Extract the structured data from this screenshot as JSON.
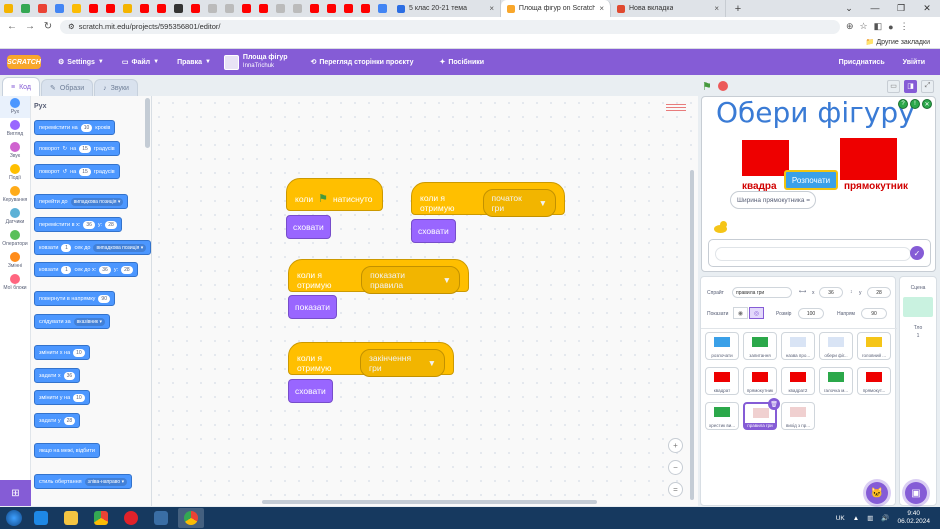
{
  "browser": {
    "tabs": [
      {
        "title": "5 клас 20-21 тема",
        "active": false,
        "color": "#2b6de3"
      },
      {
        "title": "Площа фігур on Scratch",
        "active": true,
        "color": "#f9a72b"
      },
      {
        "title": "Нова вкладка",
        "active": false,
        "color": "#e0492f"
      }
    ],
    "url": "scratch.mit.edu/projects/595356801/editor/",
    "other_bookmarks": "Другие закладки"
  },
  "menubar": {
    "logo": "SCRATCH",
    "settings": "Settings",
    "file": "Файл",
    "edit": "Правка",
    "project_title": "Площа фігур",
    "project_author": "InnaTrichuk",
    "see_project": "Перегляд сторінки проєкту",
    "tutorials": "Посібники",
    "share": "Присднатись",
    "signin": "Увійти"
  },
  "editor_tabs": {
    "code": "Код",
    "costumes": "Образи",
    "sounds": "Звуки"
  },
  "categories": [
    {
      "label": "Рух",
      "color": "#4c97ff"
    },
    {
      "label": "Вигляд",
      "color": "#9966ff"
    },
    {
      "label": "Звук",
      "color": "#cf63cf"
    },
    {
      "label": "Події",
      "color": "#ffbf00"
    },
    {
      "label": "Керування",
      "color": "#ffab19"
    },
    {
      "label": "Датчики",
      "color": "#5cb1d6"
    },
    {
      "label": "Оператори",
      "color": "#59c059"
    },
    {
      "label": "Змінні",
      "color": "#ff8c1a"
    },
    {
      "label": "Мої блоки",
      "color": "#ff6680"
    }
  ],
  "palette": {
    "heading": "Рух",
    "blocks": [
      {
        "parts": [
          "перемістити на",
          "10",
          "кроків"
        ]
      },
      {
        "parts": [
          "поворот",
          "↻",
          "на",
          "15",
          "градусів"
        ]
      },
      {
        "parts": [
          "поворот",
          "↺",
          "на",
          "15",
          "градусів"
        ]
      },
      {
        "parts": [
          "перейти до",
          "випадкова позиція ▾"
        ]
      },
      {
        "parts": [
          "перемістити в x:",
          "36",
          "y:",
          "28"
        ]
      },
      {
        "parts": [
          "ковзати",
          "1",
          "сек до",
          "випадкова позиція ▾"
        ]
      },
      {
        "parts": [
          "ковзати",
          "1",
          "сек до x:",
          "36",
          "y:",
          "28"
        ]
      },
      {
        "parts": [
          "повернути в напрямку",
          "90"
        ]
      },
      {
        "parts": [
          "слідувати за",
          "вказівник ▾"
        ]
      },
      {
        "parts": [
          "змінити x на",
          "10"
        ]
      },
      {
        "parts": [
          "задати x",
          "36"
        ]
      },
      {
        "parts": [
          "змінити y на",
          "10"
        ]
      },
      {
        "parts": [
          "задати y",
          "28"
        ]
      },
      {
        "parts": [
          "якщо на межі, відбити"
        ]
      },
      {
        "parts": [
          "стиль обертання",
          "зліва-направо ▾"
        ]
      }
    ]
  },
  "scripts": {
    "s1_hat": "коли",
    "s1_hat_tail": "натиснуто",
    "s1_block": "сховати",
    "s2_hat": "коли я отримую",
    "s2_msg": "початок гри",
    "s2_block": "сховати",
    "s3_hat": "коли я отримую",
    "s3_msg": "показати правила",
    "s3_block": "показати",
    "s4_hat": "коли я отримую",
    "s4_msg": "закінчення гри",
    "s4_block": "сховати"
  },
  "stage": {
    "title": "Обери фігуру",
    "label_left": "квадра",
    "label_right": "прямокутник",
    "start_button": "Розпочати",
    "bubble": "Ширина прямокутника ="
  },
  "sprite_info": {
    "sprite_label": "Спрайт",
    "sprite_name": "правила гри",
    "x_label": "x",
    "x_value": "36",
    "y_label": "y",
    "y_value": "28",
    "show_label": "Показати",
    "size_label": "Розмір",
    "size_value": "100",
    "direction_label": "Напрям",
    "direction_value": "90"
  },
  "sprites": [
    {
      "name": "розпочати",
      "selected": false,
      "thumb": "#3aa0e8"
    },
    {
      "name": "запитання",
      "selected": false,
      "thumb": "#2ba84a"
    },
    {
      "name": "назва про...",
      "selected": false,
      "thumb": "#d9e4f5"
    },
    {
      "name": "обери фіг...",
      "selected": false,
      "thumb": "#d9e4f5"
    },
    {
      "name": "головний ...",
      "selected": false,
      "thumb": "#f5c518"
    },
    {
      "name": "квадрат",
      "selected": false,
      "thumb": "#ee0000"
    },
    {
      "name": "прямокутник",
      "selected": false,
      "thumb": "#ee0000"
    },
    {
      "name": "квадрат2",
      "selected": false,
      "thumb": "#ee0000"
    },
    {
      "name": "галочка м...",
      "selected": false,
      "thumb": "#2ba84a"
    },
    {
      "name": "прямокут...",
      "selected": false,
      "thumb": "#ee0000"
    },
    {
      "name": "хрестик ви...",
      "selected": false,
      "thumb": "#2ba84a"
    },
    {
      "name": "правила гри",
      "selected": true,
      "thumb": "#f0d0d0"
    },
    {
      "name": "вихід з пр...",
      "selected": false,
      "thumb": "#f0d0d0"
    }
  ],
  "stage_pane": {
    "heading": "Сцена",
    "backdrops_label": "Тло",
    "backdrops_count": "1"
  },
  "taskbar": {
    "lang": "UK",
    "time": "9:40",
    "date": "06.02.2024"
  }
}
